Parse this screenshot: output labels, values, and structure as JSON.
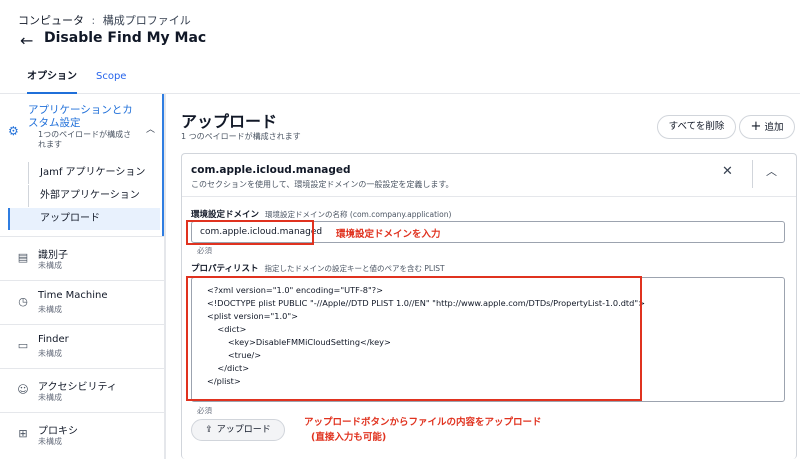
{
  "header": {
    "breadcrumb_parent": "コンピュータ",
    "breadcrumb_sep": ":",
    "breadcrumb_current": "構成プロファイル",
    "title": "Disable Find My Mac"
  },
  "tabs": [
    {
      "label": "オプション",
      "active": true
    },
    {
      "label": "Scope",
      "active": false
    }
  ],
  "sidebar": {
    "group": {
      "title": "アプリケーションとカスタム設定",
      "subtitle": "1つのペイロードが構成されます",
      "items": [
        {
          "label": "Jamf アプリケーション"
        },
        {
          "label": "外部アプリケーション"
        },
        {
          "label": "アップロード",
          "active": true
        }
      ]
    },
    "items": [
      {
        "label": "識別子",
        "status": "未構成",
        "icon": "id-card-icon"
      },
      {
        "label": "Time Machine",
        "status": "未構成",
        "icon": "time-machine-icon"
      },
      {
        "label": "Finder",
        "status": "未構成",
        "icon": "finder-icon"
      },
      {
        "label": "アクセシビリティ",
        "status": "未構成",
        "icon": "accessibility-icon"
      },
      {
        "label": "プロキシ",
        "status": "未構成",
        "icon": "proxy-icon"
      }
    ]
  },
  "main": {
    "title": "アップロード",
    "subtitle": "1 つのペイロードが構成されます",
    "delete_all_label": "すべてを削除",
    "add_label": "追加",
    "card": {
      "title": "com.apple.icloud.managed",
      "description": "このセクションを使用して、環境設定ドメインの一般設定を定義します。",
      "domain_label": "環境設定ドメイン",
      "domain_hint": "環境設定ドメインの名称 (com.company.application)",
      "domain_value": "com.apple.icloud.managed",
      "required_1": "必須",
      "plist_label": "プロパティリスト",
      "plist_hint": "指定したドメインの設定キーと値のペアを含む PLIST",
      "plist_lines": [
        "<?xml version=\"1.0\" encoding=\"UTF-8\"?>",
        "<!DOCTYPE plist PUBLIC \"-//Apple//DTD PLIST 1.0//EN\" \"http://www.apple.com/DTDs/PropertyList-1.0.dtd\">",
        "<plist version=\"1.0\">",
        "    <dict>",
        "        <key>DisableFMMiCloudSetting</key>",
        "        <true/>",
        "    </dict>",
        "</plist>"
      ],
      "required_2": "必須",
      "upload_label": "アップロード"
    }
  },
  "annotations": {
    "domain_note": "環境設定ドメインを入力",
    "upload_note_line1": "アップロードボタンからファイルの内容をアップロード",
    "upload_note_line2": "(直接入力も可能)"
  },
  "colors": {
    "accent": "#1f6fd9",
    "annotation_red": "#e0321f"
  }
}
